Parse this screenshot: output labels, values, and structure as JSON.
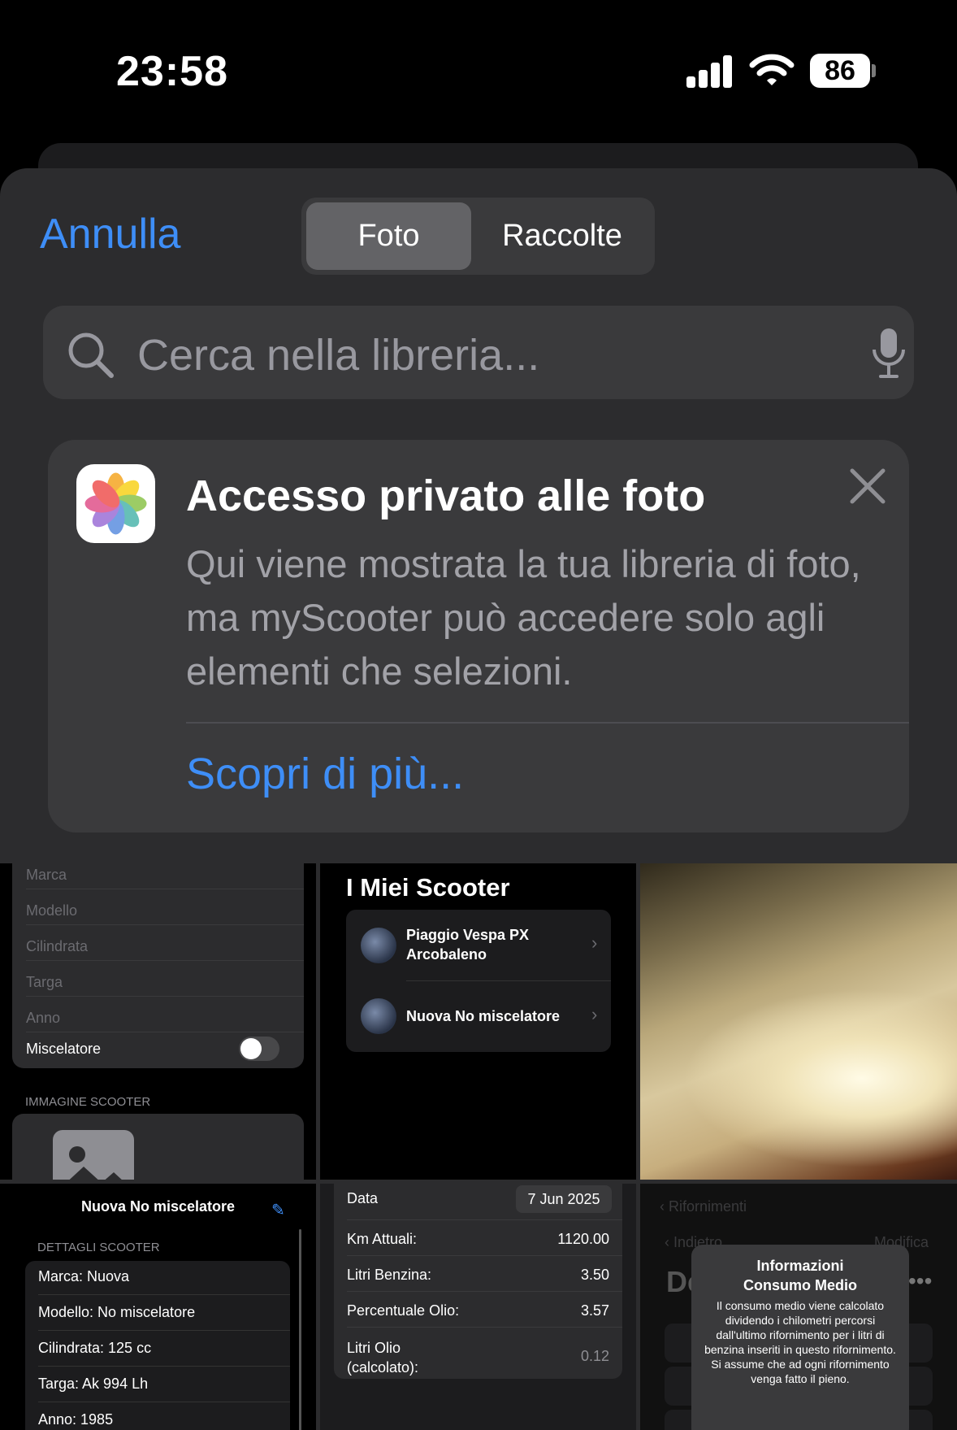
{
  "status_bar": {
    "time": "23:58",
    "battery": "86",
    "signal_bars": 4
  },
  "header": {
    "cancel_label": "Annulla",
    "segments": [
      {
        "label": "Foto",
        "selected": true
      },
      {
        "label": "Raccolte",
        "selected": false
      }
    ]
  },
  "search": {
    "placeholder": "Cerca nella libreria..."
  },
  "privacy_card": {
    "title": "Accesso privato alle foto",
    "description": "Qui viene mostrata la tua libreria di foto, ma myScooter può accedere solo agli elementi che selezioni.",
    "learn_more": "Scopri di più..."
  },
  "thumbnails": {
    "t1": {
      "rows": [
        "Marca",
        "Modello",
        "Cilindrata",
        "Targa",
        "Anno"
      ],
      "toggle_label": "Miscelatore",
      "toggle_on": false,
      "section": "IMMAGINE SCOOTER"
    },
    "t2": {
      "title": "I Miei Scooter",
      "items": [
        "Piaggio Vespa PX\nArcobaleno",
        "Nuova No miscelatore"
      ]
    },
    "t4": {
      "nav_title": "Nuova No miscelatore",
      "section": "DETTAGLI SCOOTER",
      "rows": [
        "Marca: Nuova",
        "Modello: No miscelatore",
        "Cilindrata: 125 cc",
        "Targa: Ak 994 Lh",
        "Anno: 1985"
      ]
    },
    "t5": {
      "date_label": "Data",
      "date_value": "7 Jun 2025",
      "rows": [
        {
          "label": "Km Attuali:",
          "value": "1120.00"
        },
        {
          "label": "Litri Benzina:",
          "value": "3.50"
        },
        {
          "label": "Percentuale Olio:",
          "value": "3.57"
        },
        {
          "label": "Litri Olio\n(calcolato):",
          "value": "0.12"
        }
      ]
    },
    "t6": {
      "back_label": "Rifornimenti",
      "back2_label": "Indietro",
      "edit_label": "Modifica",
      "big_letters": "De",
      "popup_title": "Informazioni\nConsumo Medio",
      "popup_body": "Il consumo medio viene calcolato dividendo i chilometri percorsi dall'ultimo rifornimento per i litri di benzina inseriti in questo rifornimento. Si assume che ad ogni rifornimento venga fatto il pieno."
    }
  },
  "colors": {
    "accent": "#3e8ef7",
    "sheet": "#2c2c2e",
    "control": "#3a3a3c"
  }
}
